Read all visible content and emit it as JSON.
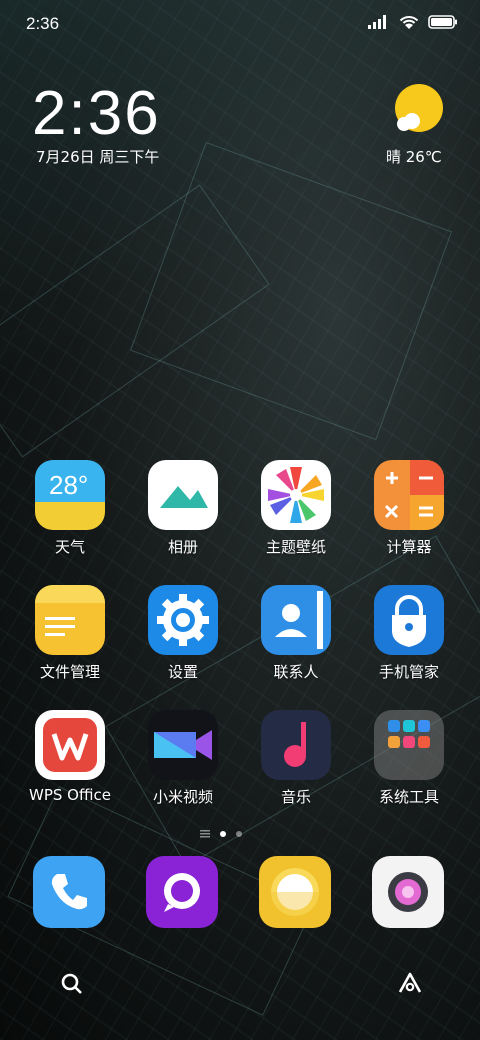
{
  "status_bar": {
    "time": "2:36"
  },
  "lock": {
    "clock": "2:36",
    "date": "7月26日 周三下午",
    "weather": "晴 26℃"
  },
  "apps": [
    {
      "label": "天气",
      "icon": "weather-icon",
      "badge_text": "28°"
    },
    {
      "label": "相册",
      "icon": "gallery-icon"
    },
    {
      "label": "主题壁纸",
      "icon": "themes-icon"
    },
    {
      "label": "计算器",
      "icon": "calculator-icon"
    },
    {
      "label": "文件管理",
      "icon": "folder-icon"
    },
    {
      "label": "设置",
      "icon": "gear-icon"
    },
    {
      "label": "联系人",
      "icon": "contacts-icon"
    },
    {
      "label": "手机管家",
      "icon": "security-icon"
    },
    {
      "label": "WPS Office",
      "icon": "wps-icon"
    },
    {
      "label": "小米视频",
      "icon": "video-icon"
    },
    {
      "label": "音乐",
      "icon": "music-icon"
    },
    {
      "label": "系统工具",
      "icon": "folder-system-tools-icon"
    }
  ],
  "dock": [
    {
      "icon": "phone-icon"
    },
    {
      "icon": "messages-icon"
    },
    {
      "icon": "browser-icon"
    },
    {
      "icon": "camera-icon"
    }
  ],
  "bottom_bar": {
    "left": "search-icon",
    "right": "assistant-icon"
  },
  "colors": {
    "weather": "#f5c623",
    "calculator": "#f2913a",
    "files": "#f6c232",
    "settings": "#1e8ae8",
    "contacts": "#2f8fe6",
    "security": "#1d79d8",
    "wps": "#e5473c",
    "video": "#111318",
    "music": "#242b45",
    "phone": "#3ea3f2",
    "messages": "#8a22d6",
    "browser": "#f2c22e",
    "camera": "#f3f3f3"
  }
}
